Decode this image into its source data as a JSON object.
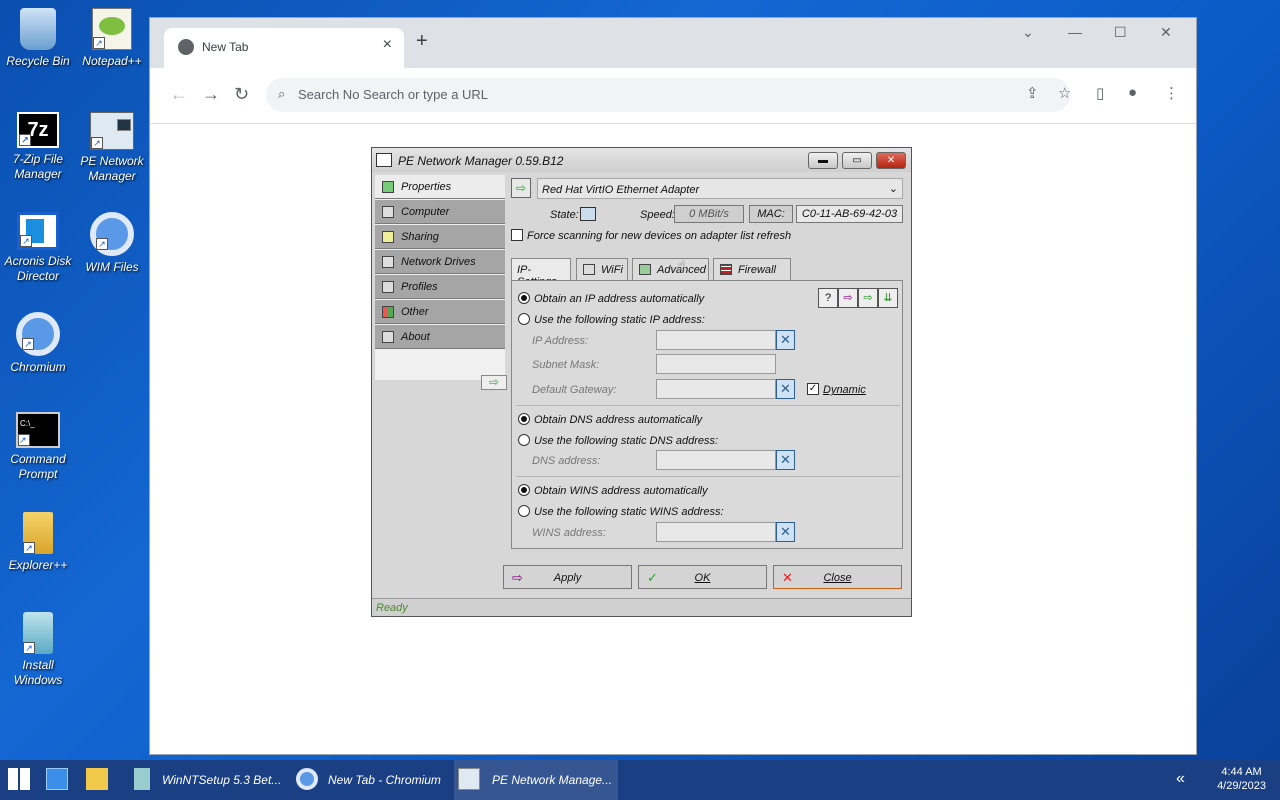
{
  "desktop": {
    "icons": [
      {
        "label": "Recycle Bin",
        "icon": "recycle-bin-icon"
      },
      {
        "label": "Notepad++",
        "icon": "notepad-plus-plus-icon"
      },
      {
        "label": "7-Zip File Manager",
        "icon": "seven-zip-icon"
      },
      {
        "label": "PE Network Manager",
        "icon": "network-manager-icon"
      },
      {
        "label": "Acronis Disk Director",
        "icon": "acronis-icon"
      },
      {
        "label": "WIM Files",
        "icon": "wim-files-icon"
      },
      {
        "label": "Chromium",
        "icon": "chromium-icon"
      },
      {
        "label": "Command Prompt",
        "icon": "command-prompt-icon"
      },
      {
        "label": "Explorer++",
        "icon": "explorer-plus-icon"
      },
      {
        "label": "Install Windows",
        "icon": "install-windows-icon"
      }
    ]
  },
  "browser": {
    "tab_title": "New Tab",
    "tab_close": "×",
    "new_tab": "+",
    "omnibox_placeholder": "Search No Search or type a URL",
    "window_controls": [
      "⌄",
      "—",
      "☐",
      "✕"
    ]
  },
  "pnm": {
    "title": "PE Network Manager 0.59.B12",
    "sidebar": [
      "Properties",
      "Computer",
      "Sharing",
      "Network Drives",
      "Profiles",
      "Other",
      "About"
    ],
    "adapter": "Red Hat VirtIO Ethernet Adapter",
    "state_label": "State:",
    "speed_label": "Speed:",
    "speed_value": "0 MBit/s",
    "mac_label": "MAC:",
    "mac_value": "C0-11-AB-69-42-03",
    "force_scan": "Force scanning for new devices on adapter list refresh",
    "tabs": [
      "IP-Settings",
      "WiFi",
      "Advanced",
      "Firewall"
    ],
    "ip": {
      "auto": "Obtain an IP address automatically",
      "static": "Use the following static IP address:",
      "ip_label": "IP Address:",
      "subnet_label": "Subnet Mask:",
      "gateway_label": "Default Gateway:",
      "dynamic": "Dynamic"
    },
    "dns": {
      "auto": "Obtain DNS address automatically",
      "static": "Use the following static DNS address:",
      "label": "DNS address:"
    },
    "wins": {
      "auto": "Obtain WINS address automatically",
      "static": "Use the following static WINS address:",
      "label": "WINS address:"
    },
    "buttons": {
      "apply": "Apply",
      "ok": "OK",
      "close": "Close"
    },
    "status": "Ready"
  },
  "taskbar": {
    "items": [
      {
        "label": "WinNTSetup 5.3 Bet..."
      },
      {
        "label": "New Tab - Chromium"
      },
      {
        "label": "PE Network Manage..."
      }
    ],
    "time": "4:44 AM",
    "date": "4/29/2023"
  }
}
